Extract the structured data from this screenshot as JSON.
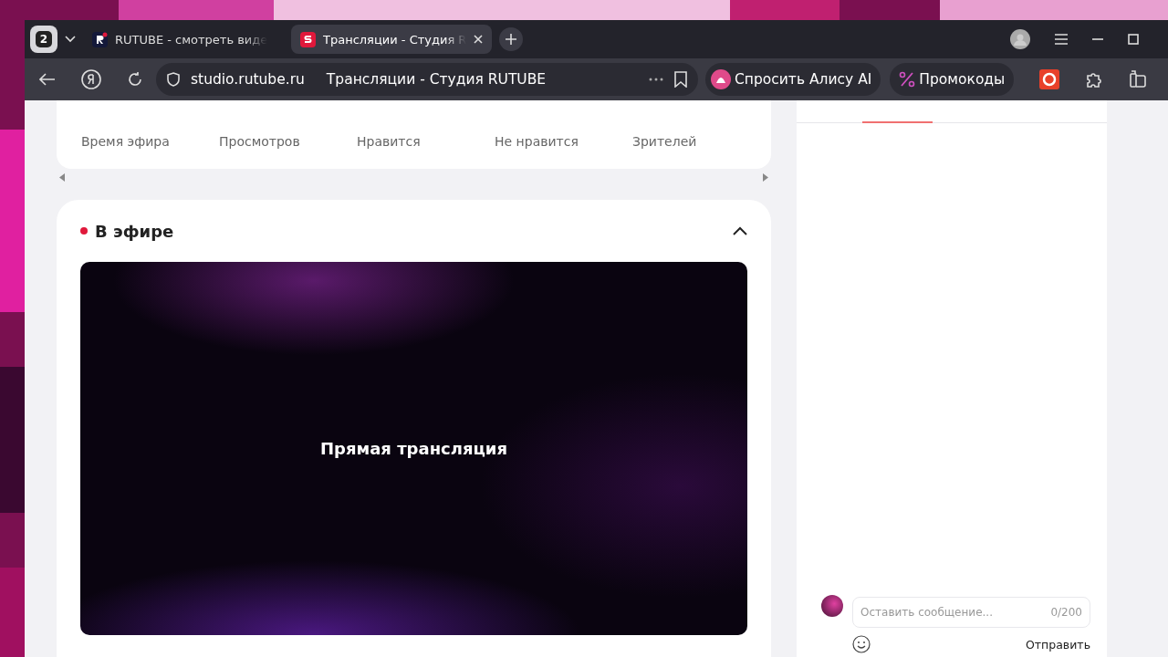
{
  "browser": {
    "tab_count": "2",
    "tabs": [
      {
        "title": "RUTUBE - смотреть виде",
        "selected": false,
        "kind": "rutube"
      },
      {
        "title": "Трансляции - Студия R",
        "selected": true,
        "kind": "studio"
      }
    ],
    "address": {
      "domain": "studio.rutube.ru",
      "page_title": "Трансляции - Студия RUTUBE"
    },
    "alice_button": "Спросить Алису AI",
    "promo_button": "Промокоды"
  },
  "stats": {
    "labels": [
      "Время эфира",
      "Просмотров",
      "Нравится",
      "Не нравится",
      "Зрителей"
    ]
  },
  "live": {
    "title": "В эфире",
    "live": true,
    "expanded": true,
    "preview_text": "Прямая трансляция"
  },
  "chat": {
    "placeholder": "Оставить сообщение...",
    "counter": "0/200",
    "send_button": "Отправить"
  }
}
